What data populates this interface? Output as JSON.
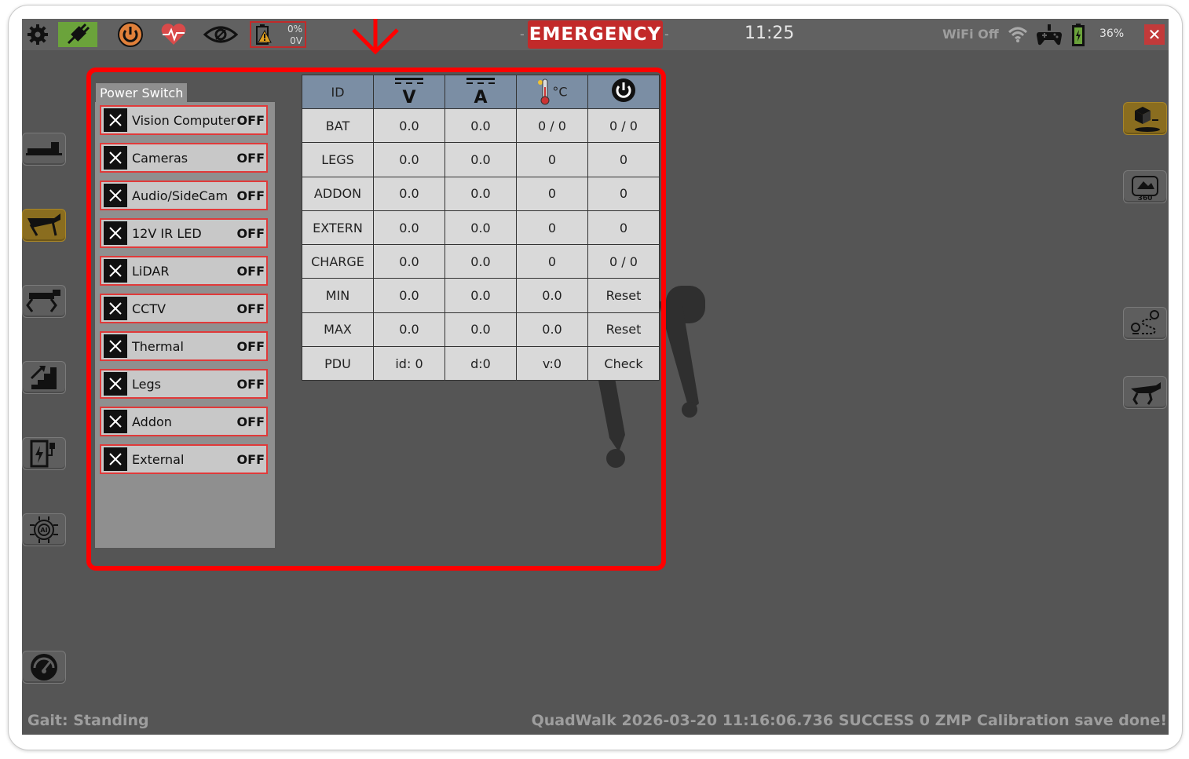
{
  "topbar": {
    "battery_warn": {
      "percent": "0%",
      "voltage": "0V"
    },
    "emergency_label": "EMERGENCY",
    "time": "11:25",
    "wifi_label": "WiFi Off",
    "battery_percent": "36%",
    "close_label": "✕",
    "icons": [
      "gear-icon",
      "plug-icon",
      "power-icon",
      "heartbeat-icon",
      "eye-icon",
      "battery-warning-icon",
      "wifi-icon",
      "gamepad-icon",
      "battery-icon",
      "close-icon"
    ]
  },
  "left_buttons": [
    "robot-lying-icon",
    "robot-sitting-icon",
    "robot-standing-icon",
    "stairs-icon",
    "charging-station-icon",
    "ai-chip-icon",
    "speedometer-icon"
  ],
  "right_buttons": [
    "box-view-icon",
    "camera-360-icon",
    "route-icon",
    "robot-dog-icon"
  ],
  "power_switch": {
    "title": "Power Switch",
    "items": [
      {
        "label": "Vision Computer",
        "state": "OFF"
      },
      {
        "label": "Cameras",
        "state": "OFF"
      },
      {
        "label": "Audio/SideCam",
        "state": "OFF"
      },
      {
        "label": "12V IR LED",
        "state": "OFF"
      },
      {
        "label": "LiDAR",
        "state": "OFF"
      },
      {
        "label": "CCTV",
        "state": "OFF"
      },
      {
        "label": "Thermal",
        "state": "OFF"
      },
      {
        "label": "Legs",
        "state": "OFF"
      },
      {
        "label": "Addon",
        "state": "OFF"
      },
      {
        "label": "External",
        "state": "OFF"
      }
    ]
  },
  "table": {
    "headers": [
      "ID",
      "V",
      "A",
      "°C",
      "power-icon"
    ],
    "rows": [
      [
        "BAT",
        "0.0",
        "0.0",
        "0 / 0",
        "0 / 0"
      ],
      [
        "LEGS",
        "0.0",
        "0.0",
        "0",
        "0"
      ],
      [
        "ADDON",
        "0.0",
        "0.0",
        "0",
        "0"
      ],
      [
        "EXTERN",
        "0.0",
        "0.0",
        "0",
        "0"
      ],
      [
        "CHARGE",
        "0.0",
        "0.0",
        "0",
        "0 / 0"
      ],
      [
        "MIN",
        "0.0",
        "0.0",
        "0.0",
        "Reset"
      ],
      [
        "MAX",
        "0.0",
        "0.0",
        "0.0",
        "Reset"
      ],
      [
        "PDU",
        "id: 0",
        "d:0",
        "v:0",
        "Check"
      ]
    ]
  },
  "status": {
    "gait": "Gait: Standing",
    "message": "QuadWalk 2026-03-20 11:16:06.736 SUCCESS 0 ZMP Calibration save done!"
  },
  "colors": {
    "emergency": "#c22a2a",
    "highlight": "#ff0000",
    "active_button": "#8a6d1f",
    "table_header": "#7b8ea4"
  }
}
